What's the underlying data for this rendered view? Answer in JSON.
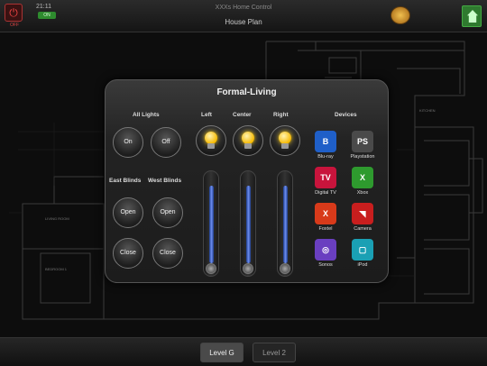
{
  "header": {
    "power_label": "OFF",
    "clock": "21:11",
    "status": "ON",
    "app_title": "XXXs Home Control",
    "page_title": "House Plan"
  },
  "floorplan": {
    "rooms": [
      "KITCHEN",
      "LIVING ROOM",
      "BEDROOM 1"
    ]
  },
  "panel": {
    "title": "Formal-Living",
    "all_lights": {
      "label": "All Lights",
      "on": "On",
      "off": "Off"
    },
    "lights": [
      {
        "label": "Left",
        "level_pct": 88
      },
      {
        "label": "Center",
        "level_pct": 88
      },
      {
        "label": "Right",
        "level_pct": 88
      }
    ],
    "east_blinds": {
      "label": "East Blinds",
      "open": "Open",
      "close": "Close"
    },
    "west_blinds": {
      "label": "West Blinds",
      "open": "Open",
      "close": "Close"
    },
    "devices_label": "Devices",
    "devices": [
      {
        "label": "Blu-ray",
        "icon": "bluray-icon",
        "glyph": "B",
        "color": "#1f5fc8"
      },
      {
        "label": "Playstation",
        "icon": "playstation-icon",
        "glyph": "PS",
        "color": "#4a4a4a"
      },
      {
        "label": "Digital TV",
        "icon": "digital-tv-icon",
        "glyph": "TV",
        "color": "#c8143c"
      },
      {
        "label": "Xbox",
        "icon": "xbox-icon",
        "glyph": "X",
        "color": "#2e9a2e"
      },
      {
        "label": "Foxtel",
        "icon": "foxtel-icon",
        "glyph": "X",
        "color": "#d83a1a"
      },
      {
        "label": "Camera",
        "icon": "camera-icon",
        "glyph": "◥",
        "color": "#c81e1e"
      },
      {
        "label": "Sonos",
        "icon": "sonos-icon",
        "glyph": "◎",
        "color": "#6a3fc0"
      },
      {
        "label": "iPod",
        "icon": "ipod-icon",
        "glyph": "▢",
        "color": "#1aa0b4"
      }
    ]
  },
  "footer": {
    "tabs": [
      "Level G",
      "Level 2"
    ]
  }
}
